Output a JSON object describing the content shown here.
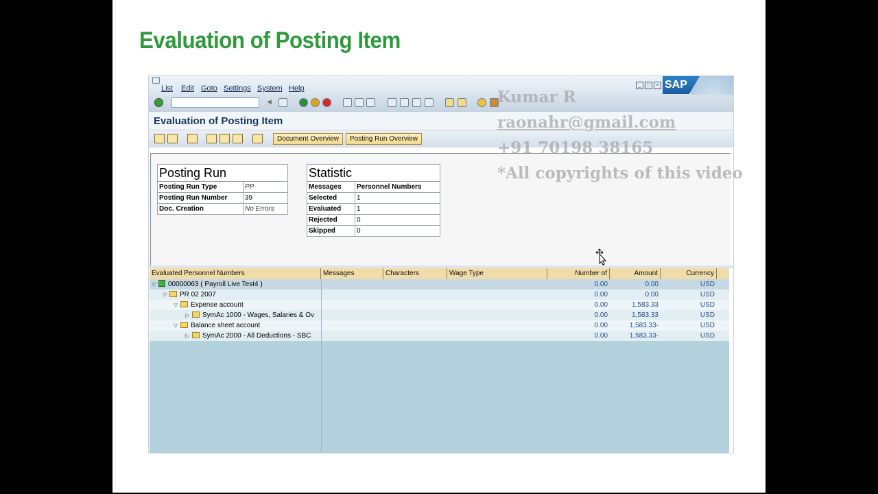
{
  "slide": {
    "title": "Evaluation of Posting Item"
  },
  "menu": [
    "List",
    "Edit",
    "Goto",
    "Settings",
    "System",
    "Help"
  ],
  "logo": "SAP",
  "app_title": "Evaluation of Posting Item",
  "app_buttons": {
    "doc_overview": "Document Overview",
    "run_overview": "Posting Run Overview"
  },
  "posting_run": {
    "heading": "Posting Run",
    "rows": [
      {
        "label": "Posting Run Type",
        "value": "PP"
      },
      {
        "label": "Posting Run Number",
        "value": "39"
      },
      {
        "label": "Doc. Creation",
        "value": "No Errors"
      }
    ]
  },
  "statistic": {
    "heading": "Statistic",
    "col1": "Messages",
    "col2": "Personnel Numbers",
    "rows": [
      {
        "label": "Selected",
        "value": "1"
      },
      {
        "label": "Evaluated",
        "value": "1"
      },
      {
        "label": "Rejected",
        "value": "0"
      },
      {
        "label": "Skipped",
        "value": "0"
      }
    ]
  },
  "grid": {
    "columns": [
      "Evaluated Personnel Numbers",
      "Messages",
      "Characters",
      "Wage Type",
      "Number of",
      "Amount",
      "Currency"
    ],
    "rows": [
      {
        "text": "00000063 ( Payroll Live Test4 )",
        "number": "0.00",
        "amount": "0.00",
        "currency": "USD"
      },
      {
        "text": "PR 02 2007",
        "number": "0.00",
        "amount": "0.00",
        "currency": "USD"
      },
      {
        "text": "Expense account",
        "number": "0.00",
        "amount": "1,583.33",
        "currency": "USD"
      },
      {
        "text": "SymAc 1000 - Wages, Salaries & Ov",
        "number": "0.00",
        "amount": "1,583.33",
        "currency": "USD"
      },
      {
        "text": "Balance sheet account",
        "number": "0.00",
        "amount": "1,583.33-",
        "currency": "USD"
      },
      {
        "text": "SymAc 2000 - All Deductions - SBC",
        "number": "0.00",
        "amount": "1,583.33-",
        "currency": "USD"
      }
    ]
  },
  "watermark": {
    "name": "Kumar R",
    "email": "raonahr@gmail.com",
    "phone": "+91 70198 38165",
    "note": "*All copyrights of this video"
  },
  "colors": {
    "slide_title": "#2e9a3c",
    "grid_header": "#efdca8",
    "grid_bg": "#b4d1de"
  }
}
